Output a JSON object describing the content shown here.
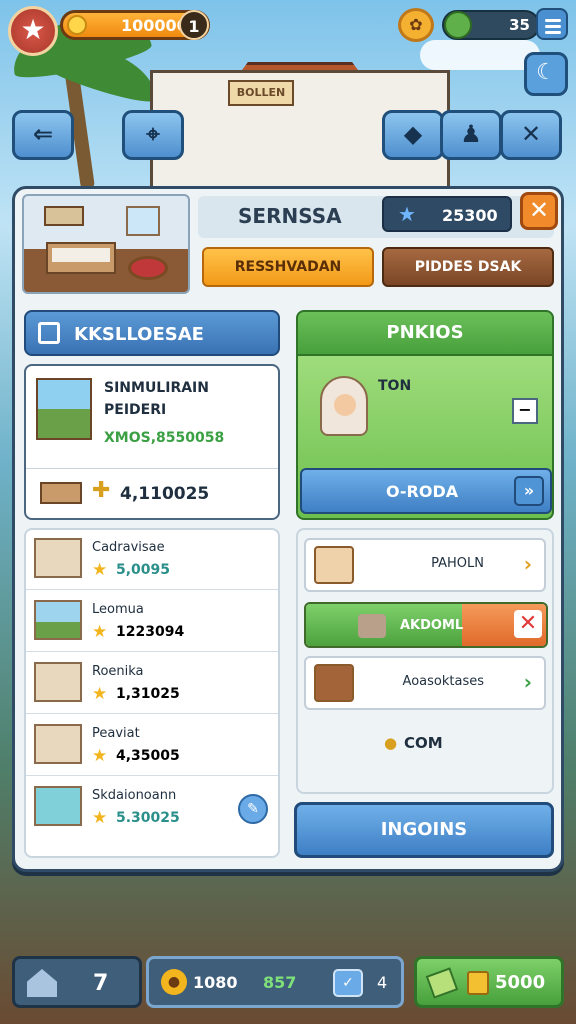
{
  "hud": {
    "coins": "100000",
    "level": "1",
    "gems": "35"
  },
  "scenery": {
    "building_sign": "BOLLEN"
  },
  "detail": {
    "room_name": "SERNSSA",
    "rating": "25300",
    "reserve_label": "RESSHVADAN",
    "price_label": "PIDDES DSAK"
  },
  "left": {
    "header": "KKSLLOESAE",
    "featured": {
      "line1": "SINMULIRAIN",
      "line2": "PEIDERI",
      "value": "XMOS,8550058",
      "count": "4,110025"
    },
    "rows": [
      {
        "name": "Cadravisae",
        "value": "5,0095",
        "color": "#2a8f8a"
      },
      {
        "name": "Leomua",
        "value": "1223094",
        "color": "#1f2f3f"
      },
      {
        "name": "Roenika",
        "value": "1,31025",
        "color": "#1f2f3f"
      },
      {
        "name": "Peaviat",
        "value": "4,35005",
        "color": "#1f2f3f"
      },
      {
        "name": "Skdaionoann",
        "value": "5.30025",
        "color": "#2a8f8a"
      }
    ]
  },
  "right": {
    "header": "PNKIOS",
    "guest": "TON",
    "action": "O-RODA",
    "items": [
      {
        "label": "PAHOLN"
      },
      {
        "label": "AKDOML"
      },
      {
        "label": "Aoasoktases"
      }
    ],
    "location": "COM",
    "bottom_button": "INGOINS"
  },
  "bottom": {
    "count": "7",
    "stat_a": "1080",
    "stat_b": "857",
    "stat_c": "4",
    "money": "5000"
  },
  "colors": {
    "panel_border": "#2f4b66",
    "accent_blue": "#3f7fc4",
    "accent_green": "#47a03c",
    "accent_orange": "#f39a18"
  }
}
